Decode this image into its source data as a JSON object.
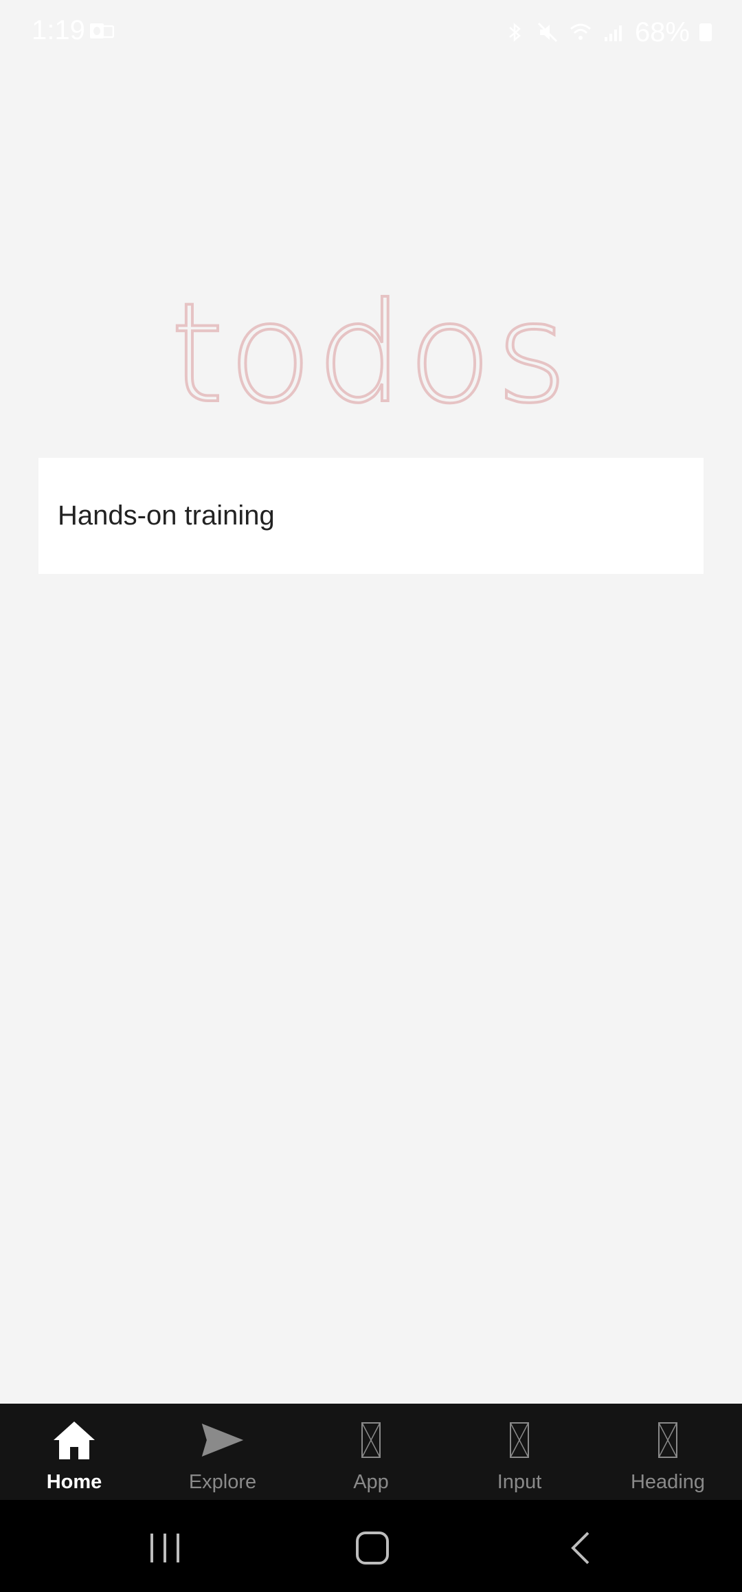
{
  "status_bar": {
    "time": "1:19",
    "battery": "68%",
    "icons": [
      "outlook-icon",
      "bluetooth-icon",
      "mute-icon",
      "wifi-icon",
      "signal-icon",
      "battery-icon"
    ]
  },
  "app": {
    "title": "todos",
    "new_todo_value": "Hands-on training"
  },
  "tab_bar": {
    "items": [
      {
        "label": "Home",
        "icon": "home-icon",
        "active": true
      },
      {
        "label": "Explore",
        "icon": "send-icon",
        "active": false
      },
      {
        "label": "App",
        "icon": "missing-glyph-icon",
        "active": false
      },
      {
        "label": "Input",
        "icon": "missing-glyph-icon",
        "active": false
      },
      {
        "label": "Heading",
        "icon": "missing-glyph-icon",
        "active": false
      }
    ]
  },
  "system_nav": {
    "buttons": [
      "recents-icon",
      "home-button-icon",
      "back-icon"
    ]
  },
  "colors": {
    "background": "#f4f4f4",
    "title": "#e6c3c4",
    "tab_bar": "#141414",
    "tab_active": "#ffffff",
    "tab_inactive": "#8a8a8a",
    "nav_bar": "#000000"
  }
}
